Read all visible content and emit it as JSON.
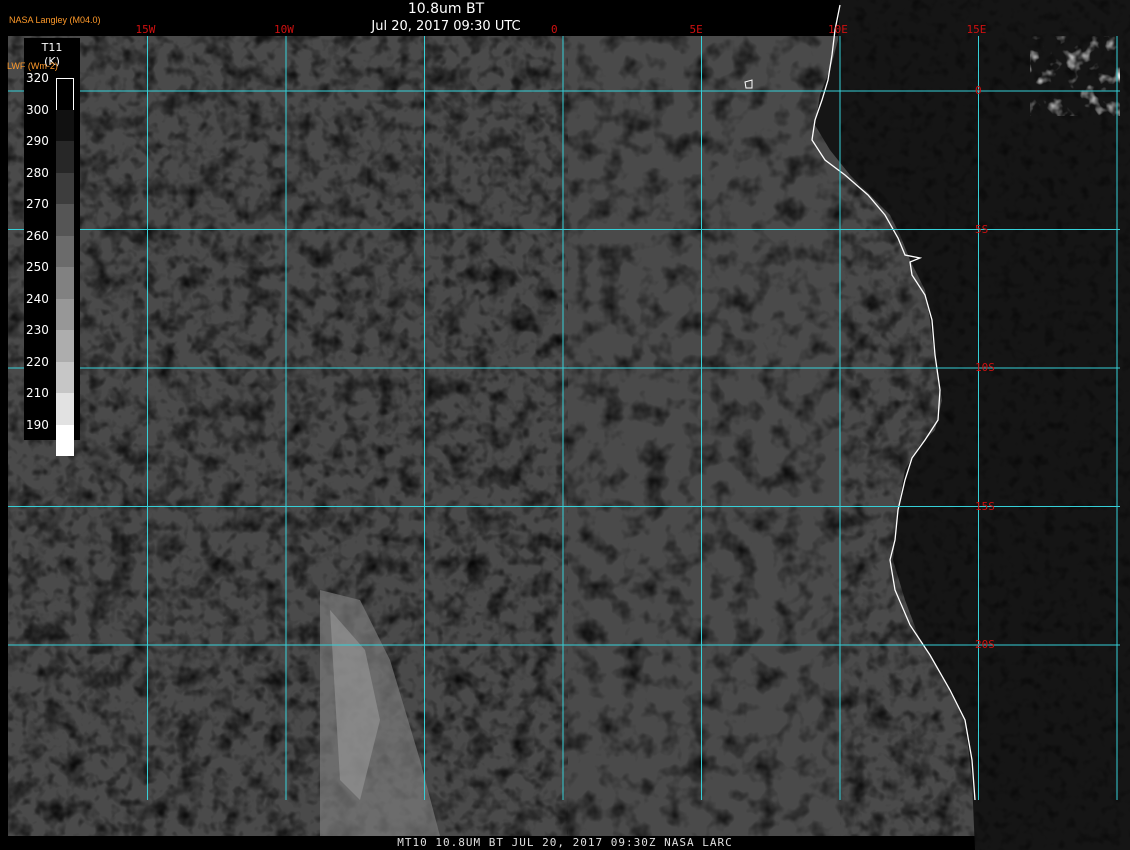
{
  "header": {
    "product": "10.8um BT",
    "datetime": "Jul 20, 2017 09:30 UTC",
    "credit": "NASA Langley (M04.0)"
  },
  "legend": {
    "variable": "T11",
    "unit": "(K)",
    "overlay_label": "LWF (Wm-2)",
    "levels": [
      {
        "value": "320",
        "color": "#000000"
      },
      {
        "value": "300",
        "color": "#111111"
      },
      {
        "value": "290",
        "color": "#272727"
      },
      {
        "value": "280",
        "color": "#3d3d3d"
      },
      {
        "value": "270",
        "color": "#555555"
      },
      {
        "value": "260",
        "color": "#6b6b6b"
      },
      {
        "value": "250",
        "color": "#818181"
      },
      {
        "value": "240",
        "color": "#979797"
      },
      {
        "value": "230",
        "color": "#adadad"
      },
      {
        "value": "220",
        "color": "#c6c6c6"
      },
      {
        "value": "210",
        "color": "#e2e2e2"
      },
      {
        "value": "190",
        "color": "#ffffff"
      }
    ]
  },
  "grid": {
    "color": "#35d0d8",
    "longitudes": [
      {
        "label": "15W",
        "lon": -15
      },
      {
        "label": "10W",
        "lon": -10
      },
      {
        "label": "0",
        "lon": 0
      },
      {
        "label": "5E",
        "lon": 5
      },
      {
        "label": "10E",
        "lon": 10
      },
      {
        "label": "15E",
        "lon": 15
      }
    ],
    "extra_meridians": [
      -5,
      20
    ],
    "latitudes": [
      {
        "label": "0",
        "lat": 0
      },
      {
        "label": "5S",
        "lat": -5
      },
      {
        "label": "10S",
        "lat": -10
      },
      {
        "label": "15S",
        "lat": -15
      },
      {
        "label": "20S",
        "lat": -20
      }
    ],
    "label_color": "#d01010"
  },
  "colors": {
    "ocean": "#4a4a4a",
    "low_cloud_dark": "#2f2f2f",
    "mid_cloud": "#7a7a7a",
    "land_dark": "#151515",
    "coastline": "#ffffff"
  },
  "footer": "MT10   10.8UM BT   JUL 20, 2017 09:30Z   NASA LARC"
}
